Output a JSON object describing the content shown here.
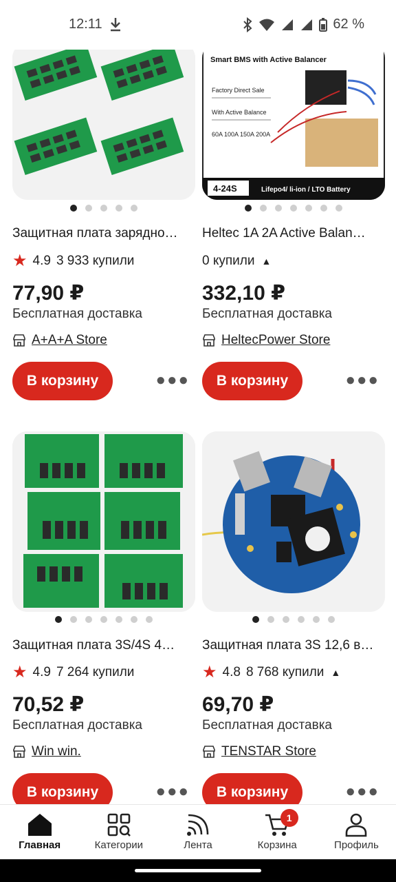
{
  "status": {
    "time": "12:11",
    "battery": "62 %"
  },
  "products": [
    {
      "title": "Защитная плата зарядно…",
      "rating": "4.9",
      "sold": "3 933 купили",
      "price": "77,90 ₽",
      "shipping": "Бесплатная доставка",
      "store": "A+A+A Store",
      "cart": "В корзину",
      "dots": 5,
      "active_dot": 0
    },
    {
      "title": "Heltec 1A 2A Active Balan…",
      "rating": "",
      "sold": "0 купили",
      "price": "332,10 ₽",
      "shipping": "Бесплатная доставка",
      "store": "HeltecPower Store",
      "cart": "В корзину",
      "dots": 7,
      "active_dot": 0,
      "image_text": {
        "title": "Smart BMS with Active Balancer",
        "line1": "Factory Direct Sale",
        "line2": "With Active Balance",
        "line3": "60A 100A 150A 200A",
        "range": "4-24S",
        "chem": "Lifepo4/ li-ion / LTO Battery"
      }
    },
    {
      "title": "Защитная плата 3S/4S 4…",
      "rating": "4.9",
      "sold": "7 264 купили",
      "price": "70,52 ₽",
      "shipping": "Бесплатная доставка",
      "store": "Win win.",
      "cart": "В корзину",
      "dots": 7,
      "active_dot": 0
    },
    {
      "title": "Защитная плата 3S 12,6 в…",
      "rating": "4.8",
      "sold": "8 768 купили",
      "price": "69,70 ₽",
      "shipping": "Бесплатная доставка",
      "store": "TENSTAR Store",
      "cart": "В корзину",
      "dots": 6,
      "active_dot": 0
    }
  ],
  "nav": {
    "home": "Главная",
    "categories": "Категории",
    "feed": "Лента",
    "cart": "Корзина",
    "profile": "Профиль",
    "cart_badge": "1"
  },
  "colors": {
    "accent": "#d8281e",
    "pcb_green": "#1f9a4a",
    "pcb_blue": "#1f5ea8"
  }
}
